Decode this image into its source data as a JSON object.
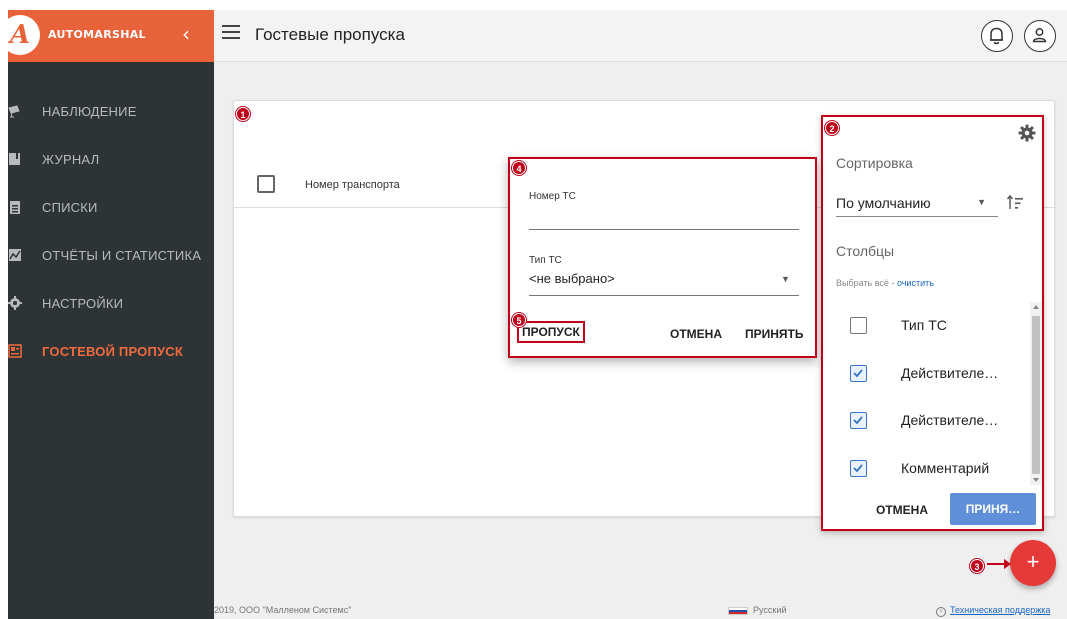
{
  "brand": {
    "name": "AUTOMARSHAL",
    "logo_letter": "A",
    "collapse_glyph": "‹"
  },
  "sidebar": {
    "items": [
      {
        "label": "НАБЛЮДЕНИЕ",
        "icon": "surveillance-camera-icon"
      },
      {
        "label": "ЖУРНАЛ",
        "icon": "journal-book-icon"
      },
      {
        "label": "СПИСКИ",
        "icon": "clipboard-list-icon"
      },
      {
        "label": "ОТЧЁТЫ И СТАТИСТИКА",
        "icon": "chart-report-icon"
      },
      {
        "label": "НАСТРОЙКИ",
        "icon": "gear-icon"
      },
      {
        "label": "ГОСТЕВОЙ ПРОПУСК",
        "icon": "guest-pass-icon",
        "active": true
      }
    ]
  },
  "header": {
    "title": "Гостевые пропуска"
  },
  "table": {
    "column_header": "Номер транспорта"
  },
  "panel": {
    "sort_heading": "Сортировка",
    "sort_value": "По умолчанию",
    "columns_heading": "Столбцы",
    "select_all": "Выбрать всё",
    "separator": " - ",
    "clear": "очистить",
    "columns": [
      {
        "label": "Тип ТС",
        "checked": false
      },
      {
        "label": "Действителе…",
        "checked": true
      },
      {
        "label": "Действителе…",
        "checked": true
      },
      {
        "label": "Комментарий",
        "checked": true
      }
    ],
    "cancel_label": "ОТМЕНА",
    "accept_label": "ПРИНЯ…"
  },
  "dialog": {
    "plate_label": "Номер ТС",
    "plate_value": "",
    "type_label": "Тип ТС",
    "type_value": "<не выбрано>",
    "skip_label": "ПРОПУСК",
    "cancel_label": "ОТМЕНА",
    "accept_label": "ПРИНЯТЬ"
  },
  "fab": {
    "label": "+"
  },
  "markers": [
    "1",
    "2",
    "3",
    "4",
    "5"
  ],
  "footer": {
    "copyright": "2019, ООО \"Малленом Системс\"",
    "language": "Русский",
    "support_icon": "i",
    "support": "Техническая поддержка"
  },
  "colors": {
    "accent": "#e8633a",
    "sidebar": "#2e3335",
    "annotation": "#c0001a",
    "fab": "#e53a37",
    "primary_button": "#5f8fd8"
  }
}
